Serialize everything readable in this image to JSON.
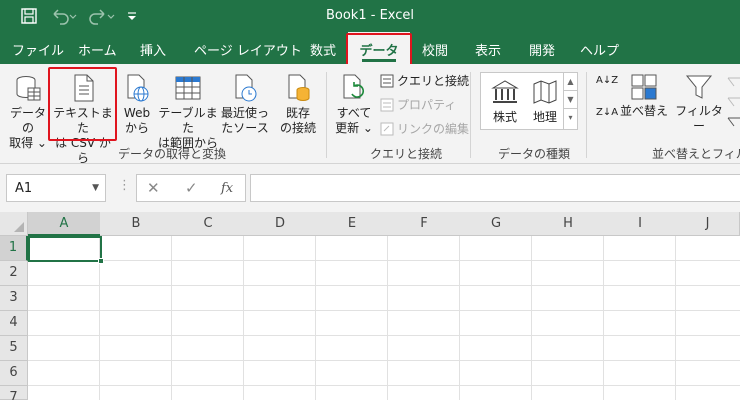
{
  "titlebar": {
    "title": "Book1  -  Excel",
    "icons": [
      "save-icon",
      "undo-icon",
      "redo-icon",
      "customize-qat-icon"
    ]
  },
  "tabs": [
    {
      "label": "ファイル"
    },
    {
      "label": "ホーム"
    },
    {
      "label": "挿入"
    },
    {
      "label": "ページ レイアウト"
    },
    {
      "label": "数式"
    },
    {
      "label": "データ",
      "active": true
    },
    {
      "label": "校閲"
    },
    {
      "label": "表示"
    },
    {
      "label": "開発"
    },
    {
      "label": "ヘルプ"
    }
  ],
  "ribbon": {
    "get_data": {
      "line1": "データの",
      "line2": "取得 ⌄"
    },
    "from_csv": {
      "line1": "テキストまた",
      "line2": "は CSV から"
    },
    "from_web": {
      "line1": "Web",
      "line2": "から"
    },
    "from_table": {
      "line1": "テーブルまた",
      "line2": "は範囲から"
    },
    "recent_sources": {
      "line1": "最近使っ",
      "line2": "たソース"
    },
    "existing_connections": {
      "line1": "既存",
      "line2": "の接続"
    },
    "group_get_transform": "データの取得と変換",
    "refresh_all": {
      "line1": "すべて",
      "line2": "更新 ⌄"
    },
    "queries_connections": "クエリと接続",
    "properties": "プロパティ",
    "edit_links": "リンクの編集",
    "group_queries": "クエリと接続",
    "data_types": {
      "stocks": "株式",
      "geography": "地理"
    },
    "group_data_types": "データの種類",
    "sort_az": "A↓Z",
    "sort_za": "Z↓A",
    "sort": "並べ替え",
    "filter": "フィルター",
    "group_sort_filter": "並べ替えとフィルター"
  },
  "formula_bar": {
    "name_box": "A1",
    "cancel": "✕",
    "enter": "✓",
    "function": "fx",
    "value": ""
  },
  "grid": {
    "columns": [
      "A",
      "B",
      "C",
      "D",
      "E",
      "F",
      "G",
      "H",
      "I",
      "J"
    ],
    "rows": [
      "1",
      "2",
      "3",
      "4",
      "5",
      "6",
      "7"
    ],
    "active_cell": "A1"
  },
  "colors": {
    "accent": "#217346",
    "highlight": "#e0141e"
  }
}
